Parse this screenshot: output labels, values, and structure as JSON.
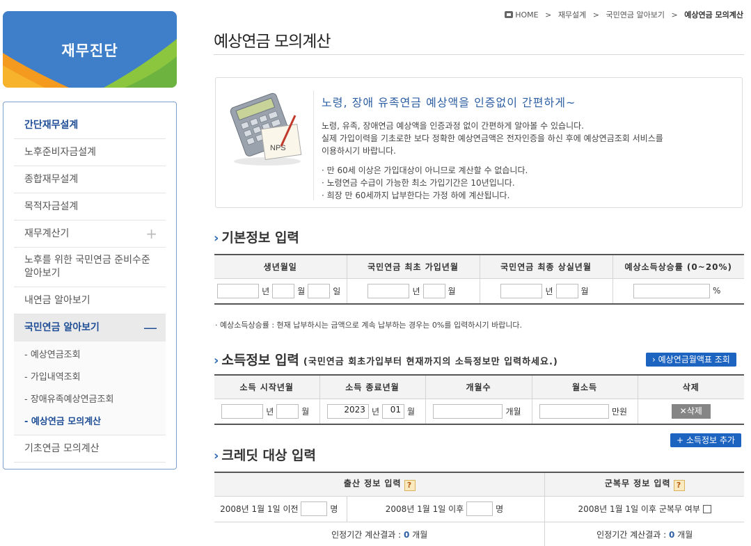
{
  "brand": {
    "title": "재무진단"
  },
  "sidebar": {
    "items": [
      {
        "label": "간단재무설계"
      },
      {
        "label": "노후준비자금설계"
      },
      {
        "label": "종합재무설계"
      },
      {
        "label": "목적자금설계"
      },
      {
        "label": "재무계산기",
        "sign": "+"
      },
      {
        "label": "노후를 위한 국민연금 준비수준 알아보기"
      },
      {
        "label": "내연금 알아보기"
      },
      {
        "label": "국민연금 알아보기",
        "sign": "—"
      },
      {
        "label": "기초연금 모의계산"
      }
    ],
    "sub_items": [
      {
        "label": "- 예상연금조회"
      },
      {
        "label": "- 가입내역조회"
      },
      {
        "label": "- 장애유족예상연금조회"
      },
      {
        "label": "- 예상연금 모의계산"
      }
    ]
  },
  "breadcrumb": {
    "home": "HOME",
    "sep": ">",
    "c1": "재무설계",
    "c2": "국민연금 알아보기",
    "current": "예상연금 모의계산"
  },
  "page": {
    "title": "예상연금 모의계산"
  },
  "intro": {
    "image_label": "NPS",
    "headline": "노령, 장애 유족연금 예상액을 인증없이 간편하게~",
    "lines": [
      "노령, 유족, 장애연금 예상액을 인증과정 없이 간편하게 알아볼 수 있습니다.",
      "실제 가입이력을 기초로한 보다 정확한 예상연금액은 전자인증을 하신 후에 예상연금조회 서비스를",
      "이용하시기 바랍니다."
    ],
    "bullets": [
      "· 만 60세 이상은 가입대상이 아니므로 계산할 수 없습니다.",
      "· 노령연금 수급이 가능한 최소 가입기간은 10년입니다.",
      "· 희장 만 60세까지 납부한다는 가정 하에 계산됩니다."
    ]
  },
  "basic": {
    "heading": "기본정보 입력",
    "cols": [
      "생년월일",
      "국민연금 최초 가입년월",
      "국민연금 최종 상실년월",
      "예상소득상승률 (0~20%)"
    ],
    "units": {
      "year": "년",
      "month": "월",
      "day": "일",
      "percent": "%"
    },
    "note": "· 예상소득상승률 : 현재 납부하시는 금액으로 계속 납부하는 경우는 0%를 입력하시기 바랍니다."
  },
  "income": {
    "heading": "소득정보 입력",
    "subheading": "(국민연금 회초가입부터 현재까지의 소득정보만 입력하세요.)",
    "lookup_button": "› 예상연금월액표 조회",
    "cols": [
      "소득 시작년월",
      "소득 종료년월",
      "개월수",
      "월소득",
      "삭제"
    ],
    "end_year": "2023",
    "end_month": "01",
    "months_unit": "개월",
    "won_unit": "만원",
    "delete_button": "✕삭제",
    "add_button": "+ 소득정보 추가"
  },
  "credit": {
    "heading": "크레딧 대상 입력",
    "cols": [
      "출산 정보 입력",
      "군복무 정보 입력"
    ],
    "help": "?",
    "before_label": "2008년 1월 1일 이전",
    "after_label": "2008년 1월 1일 이후",
    "persons_unit": "명",
    "military_label": "2008년 1월 1일 이후 군복무 여부",
    "result_label": "인정기간 계산결과 :",
    "result_value": "0",
    "result_unit": "개월"
  }
}
